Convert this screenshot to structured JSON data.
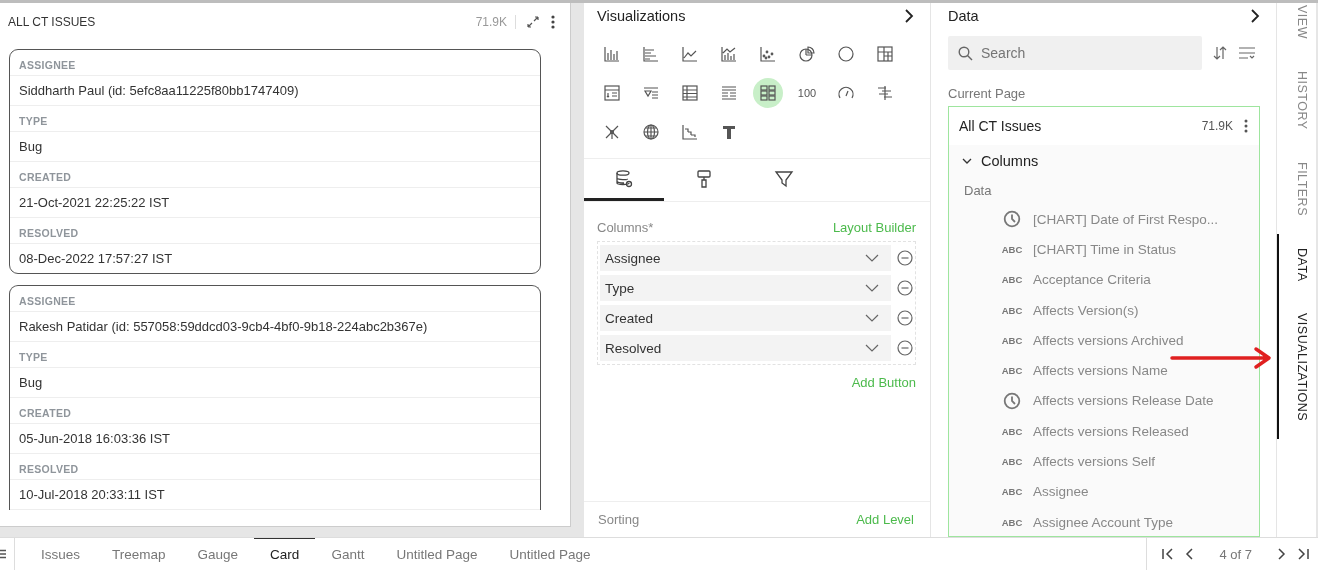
{
  "widget": {
    "title": "ALL CT ISSUES",
    "count": "71.9K",
    "cards": [
      {
        "fields": [
          {
            "label": "ASSIGNEE",
            "value": "Siddharth Paul (id: 5efc8aa11225f80bb1747409)"
          },
          {
            "label": "TYPE",
            "value": "Bug"
          },
          {
            "label": "CREATED",
            "value": "21-Oct-2021 22:25:22 IST"
          },
          {
            "label": "RESOLVED",
            "value": "08-Dec-2022 17:57:27 IST"
          }
        ]
      },
      {
        "fields": [
          {
            "label": "ASSIGNEE",
            "value": "Rakesh Patidar (id: 557058:59ddcd03-9cb4-4bf0-9b18-224abc2b367e)"
          },
          {
            "label": "TYPE",
            "value": "Bug"
          },
          {
            "label": "CREATED",
            "value": "05-Jun-2018 16:03:36 IST"
          },
          {
            "label": "RESOLVED",
            "value": "10-Jul-2018 20:33:11 IST"
          }
        ]
      }
    ]
  },
  "visualizations": {
    "title": "Visualizations",
    "chart_types": [
      {
        "kind": "bar",
        "selected": false
      },
      {
        "kind": "hbar",
        "selected": false
      },
      {
        "kind": "line",
        "selected": false
      },
      {
        "kind": "combo",
        "selected": false
      },
      {
        "kind": "scatter",
        "selected": false
      },
      {
        "kind": "pie",
        "selected": false
      },
      {
        "kind": "donut",
        "selected": false
      },
      {
        "kind": "pivot",
        "selected": false
      },
      {
        "kind": "list",
        "selected": false
      },
      {
        "kind": "filter",
        "selected": false
      },
      {
        "kind": "table",
        "selected": false
      },
      {
        "kind": "detail",
        "selected": false
      },
      {
        "kind": "card",
        "selected": true
      },
      {
        "kind": "number",
        "label": "100",
        "selected": false
      },
      {
        "kind": "gauge",
        "selected": false
      },
      {
        "kind": "gantt",
        "selected": false
      },
      {
        "kind": "network",
        "selected": false
      },
      {
        "kind": "globe",
        "selected": false
      },
      {
        "kind": "waterfall",
        "selected": false
      },
      {
        "kind": "text",
        "selected": false
      }
    ],
    "tabs": [
      {
        "kind": "data",
        "selected": true
      },
      {
        "kind": "format",
        "selected": false
      },
      {
        "kind": "filter",
        "selected": false
      }
    ],
    "columns_label": "Columns*",
    "layout_builder": "Layout Builder",
    "columns": [
      "Assignee",
      "Type",
      "Created",
      "Resolved"
    ],
    "add_button": "Add Button",
    "sorting_label": "Sorting",
    "add_level": "Add Level"
  },
  "data": {
    "title": "Data",
    "search": {
      "placeholder": "Search"
    },
    "section_label": "Current Page",
    "source": {
      "name": "All CT Issues",
      "count": "71.9K",
      "group": {
        "label": "Columns",
        "expanded": true,
        "subheading": "Data",
        "fields": [
          {
            "kind": "date",
            "name": "[CHART] Date of First Respo..."
          },
          {
            "kind": "text",
            "type_label": "ABC",
            "name": "[CHART] Time in Status"
          },
          {
            "kind": "text",
            "type_label": "ABC",
            "name": "Acceptance Criteria"
          },
          {
            "kind": "text",
            "type_label": "ABC",
            "name": "Affects Version(s)"
          },
          {
            "kind": "text",
            "type_label": "ABC",
            "name": "Affects versions Archived"
          },
          {
            "kind": "text",
            "type_label": "ABC",
            "name": "Affects versions Name"
          },
          {
            "kind": "date",
            "name": "Affects versions Release Date"
          },
          {
            "kind": "text",
            "type_label": "ABC",
            "name": "Affects versions Released"
          },
          {
            "kind": "text",
            "type_label": "ABC",
            "name": "Affects versions Self"
          },
          {
            "kind": "text",
            "type_label": "ABC",
            "name": "Assignee"
          },
          {
            "kind": "text",
            "type_label": "ABC",
            "name": "Assignee Account Type"
          }
        ]
      }
    }
  },
  "side_tabs": [
    {
      "label": "VIEW",
      "selected": false
    },
    {
      "label": "HISTORY",
      "selected": false
    },
    {
      "label": "FILTERS",
      "selected": false
    },
    {
      "label": "DATA",
      "selected": true
    },
    {
      "label": "VISUALIZATIONS",
      "selected": true
    }
  ],
  "page_tabs": [
    {
      "label": "Issues",
      "selected": false
    },
    {
      "label": "Treemap",
      "selected": false
    },
    {
      "label": "Gauge",
      "selected": false
    },
    {
      "label": "Card",
      "selected": true
    },
    {
      "label": "Gantt",
      "selected": false
    },
    {
      "label": "Untitled Page",
      "selected": false
    },
    {
      "label": "Untitled Page",
      "selected": false
    }
  ],
  "pagination": {
    "text": "4 of 7"
  }
}
